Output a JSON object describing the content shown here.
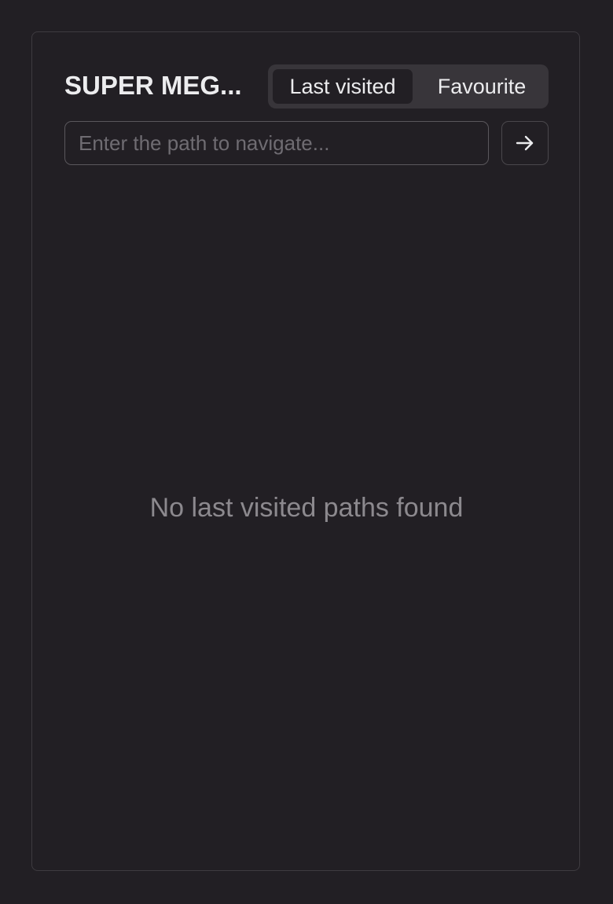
{
  "header": {
    "title": "SUPER MEG..."
  },
  "tabs": [
    {
      "label": "Last visited",
      "active": true
    },
    {
      "label": "Favourite",
      "active": false
    }
  ],
  "path_input": {
    "value": "",
    "placeholder": "Enter the path to navigate..."
  },
  "go_button": {
    "icon": "arrow-right-icon"
  },
  "empty_state": {
    "message": "No last visited paths found"
  },
  "colors": {
    "background": "#221f24",
    "panel_border": "#3e3b40",
    "tab_group_bg": "#38353a",
    "text_primary": "#ececee",
    "text_muted": "#8c898e"
  }
}
